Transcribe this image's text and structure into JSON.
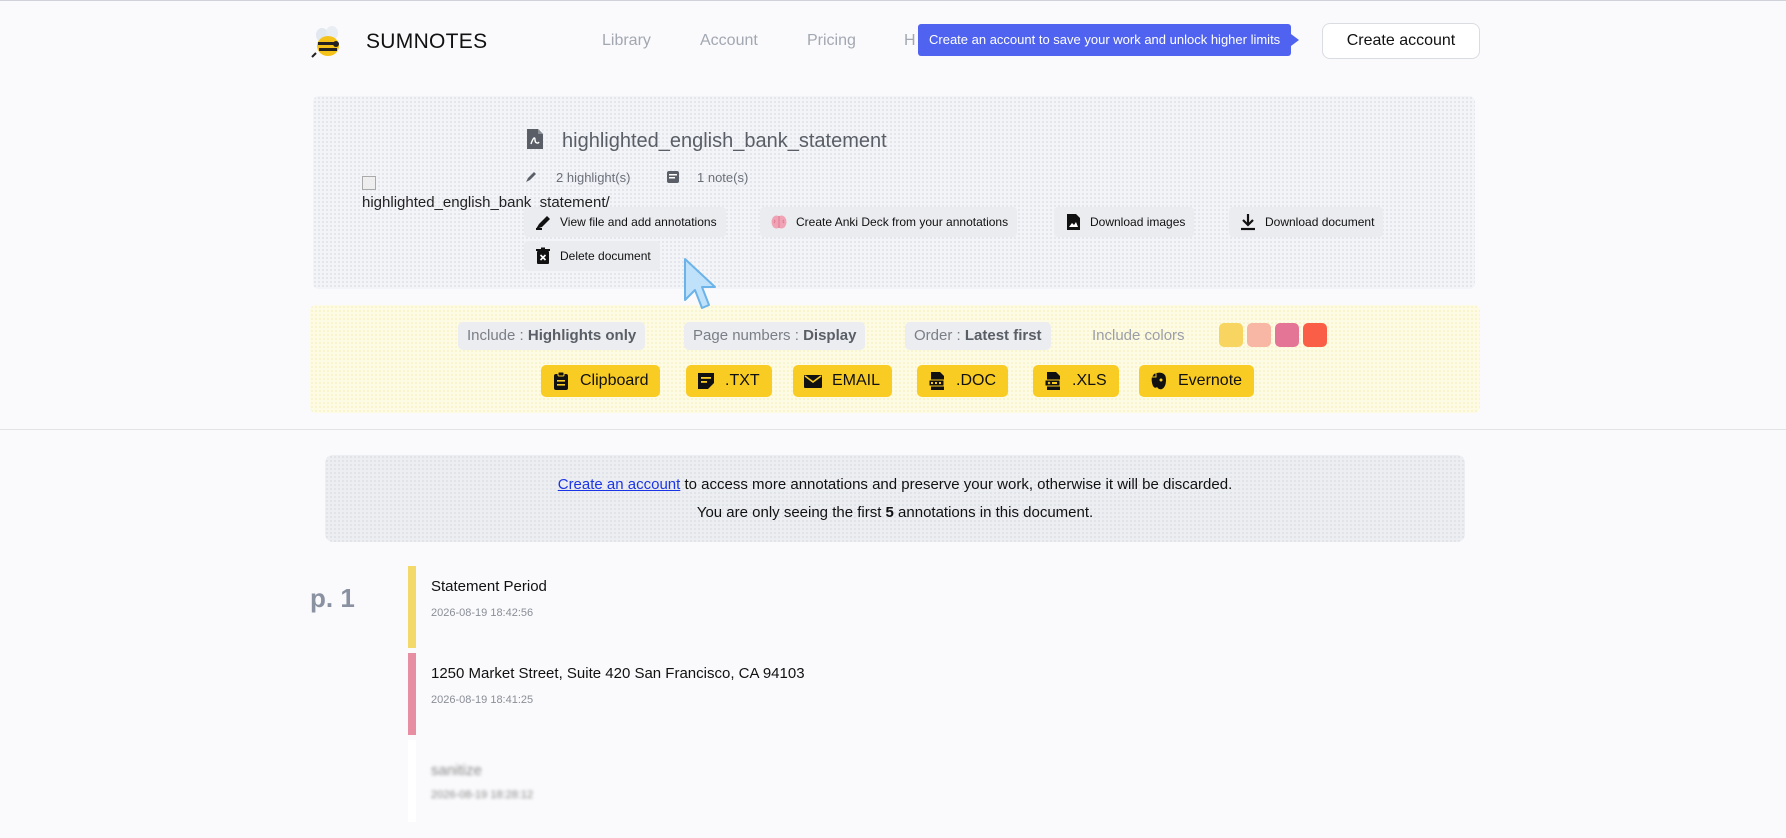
{
  "header": {
    "brand": "SUMNOTES",
    "nav": [
      "Library",
      "Account",
      "Pricing",
      "H"
    ],
    "tooltip": "Create an account to save your work and unlock higher limits",
    "create_account": "Create account"
  },
  "document": {
    "image_alt": "highlighted_english_bank_statement/",
    "title": "highlighted_english_bank_statement",
    "highlights": "2 highlight(s)",
    "notes": "1 note(s)",
    "actions": {
      "view": "View file and add annotations",
      "anki": "Create Anki Deck from your annotations",
      "images": "Download images",
      "download": "Download document",
      "delete": "Delete document"
    },
    "icons": [
      "pdf-file-icon",
      "highlighter-icon",
      "note-icon",
      "brain-icon",
      "image-file-icon",
      "download-icon",
      "trash-icon"
    ]
  },
  "options": {
    "include_label": "Include :",
    "include_value": "Highlights only",
    "page_label": "Page numbers :",
    "page_value": "Display",
    "order_label": "Order :",
    "order_value": "Latest first",
    "colors_label": "Include colors",
    "colors": [
      "#f7d560",
      "#f8b6a5",
      "#e57596",
      "#fb5e46"
    ]
  },
  "exports": [
    "Clipboard",
    ".TXT",
    "EMAIL",
    ".DOC",
    ".XLS",
    "Evernote"
  ],
  "notice": {
    "link": "Create an account",
    "line1_rest": " to access more annotations and preserve your work, otherwise it will be discarded.",
    "line2_pre": "You are only seeing the first ",
    "line2_count": "5",
    "line2_post": " annotations in this document."
  },
  "annotations": {
    "page": "p. 1",
    "items": [
      {
        "text": "Statement Period",
        "time": "2026-08-19 18:42:56",
        "color": "#f3d86a"
      },
      {
        "text": "1250 Market Street, Suite 420 San Francisco, CA 94103",
        "time": "2026-08-19 18:41:25",
        "color": "#e88ea2"
      },
      {
        "text": "sanitize",
        "time": "2026-08-19 18:28:12",
        "color": "#ffffff"
      }
    ]
  }
}
